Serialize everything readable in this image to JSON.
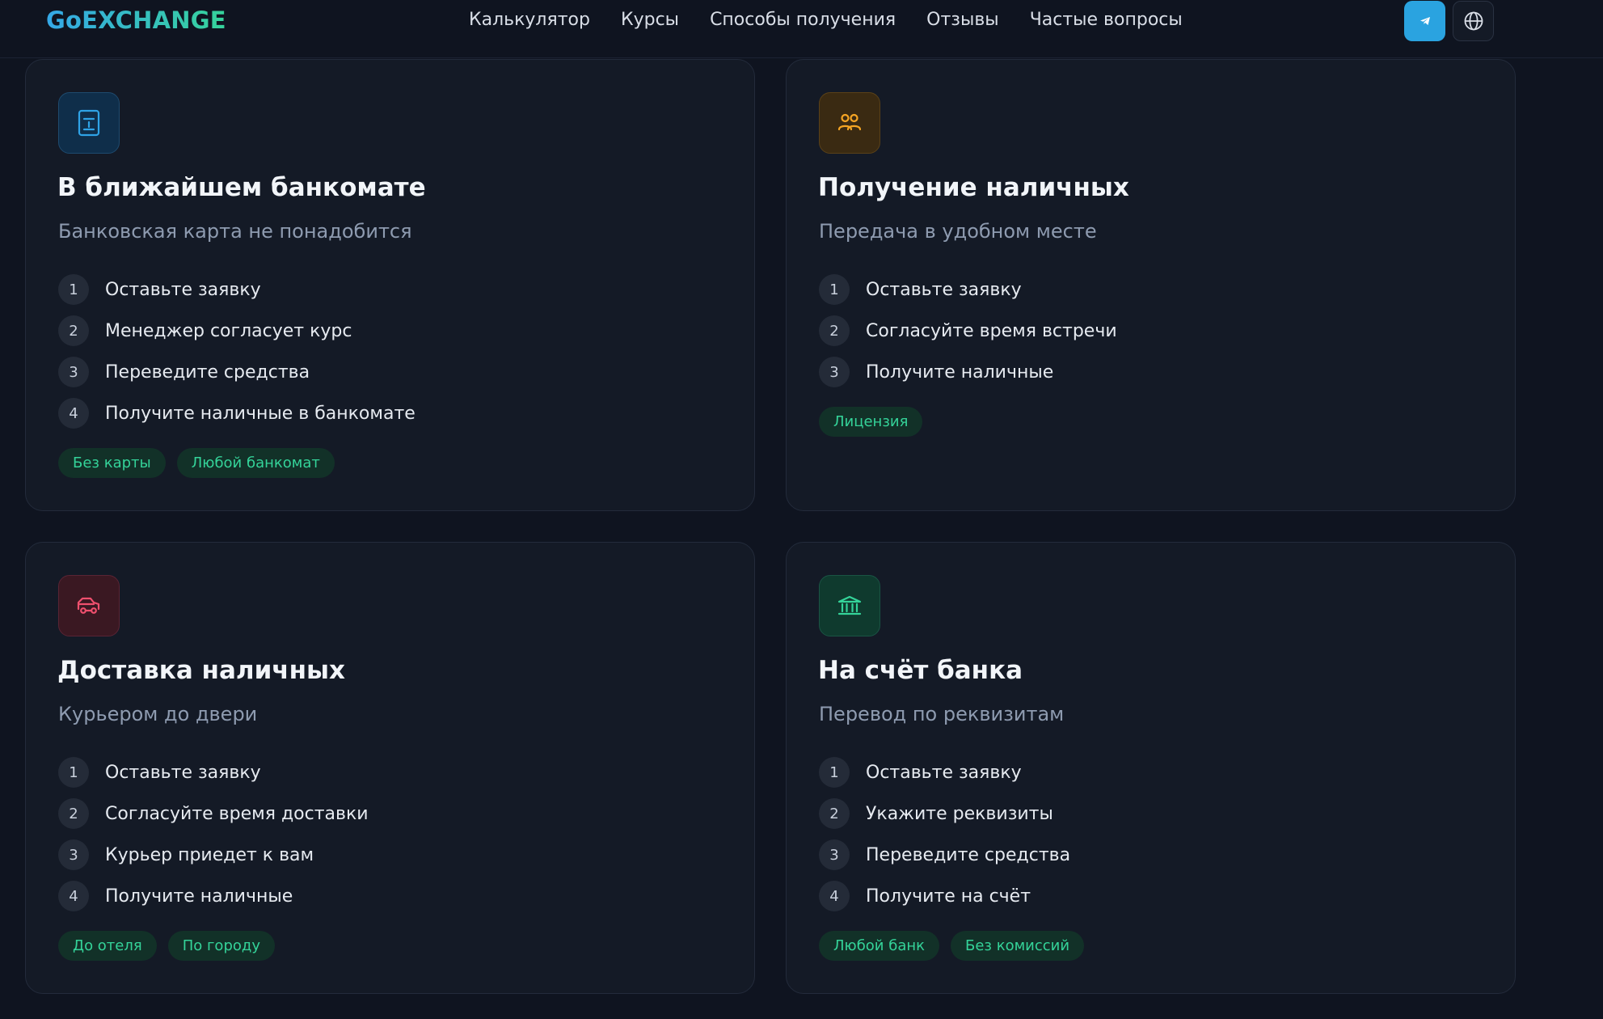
{
  "header": {
    "logo": "GoEXCHANGE",
    "nav": [
      "Калькулятор",
      "Курсы",
      "Способы получения",
      "Отзывы",
      "Частые вопросы"
    ],
    "telegram_icon": "telegram-icon",
    "language_icon": "globe-icon"
  },
  "colors": {
    "background": "#0f1420",
    "card": "#141a26",
    "accent_green": "#34d399",
    "accent_blue": "#2aa3e0"
  },
  "cards": [
    {
      "icon": "atm-icon",
      "title": "В ближайшем банкомате",
      "subtitle": "Банковская карта не понадобится",
      "steps": [
        "Оставьте заявку",
        "Менеджер согласует курс",
        "Переведите средства",
        "Получите наличные в банкомате"
      ],
      "tags": [
        "Без карты",
        "Любой банкомат"
      ]
    },
    {
      "icon": "users-icon",
      "title": "Получение наличных",
      "subtitle": "Передача в удобном месте",
      "steps": [
        "Оставьте заявку",
        "Согласуйте время встречи",
        "Получите наличные"
      ],
      "tags": [
        "Лицензия"
      ]
    },
    {
      "icon": "car-icon",
      "title": "Доставка наличных",
      "subtitle": "Курьером до двери",
      "steps": [
        "Оставьте заявку",
        "Согласуйте время доставки",
        "Курьер приедет к вам",
        "Получите наличные"
      ],
      "tags": [
        "До отеля",
        "По городу"
      ]
    },
    {
      "icon": "bank-icon",
      "title": "На счёт банка",
      "subtitle": "Перевод по реквизитам",
      "steps": [
        "Оставьте заявку",
        "Укажите реквизиты",
        "Переведите средства",
        "Получите на счёт"
      ],
      "tags": [
        "Любой банк",
        "Без комиссий"
      ]
    }
  ],
  "step_numbers": [
    "1",
    "2",
    "3",
    "4"
  ]
}
